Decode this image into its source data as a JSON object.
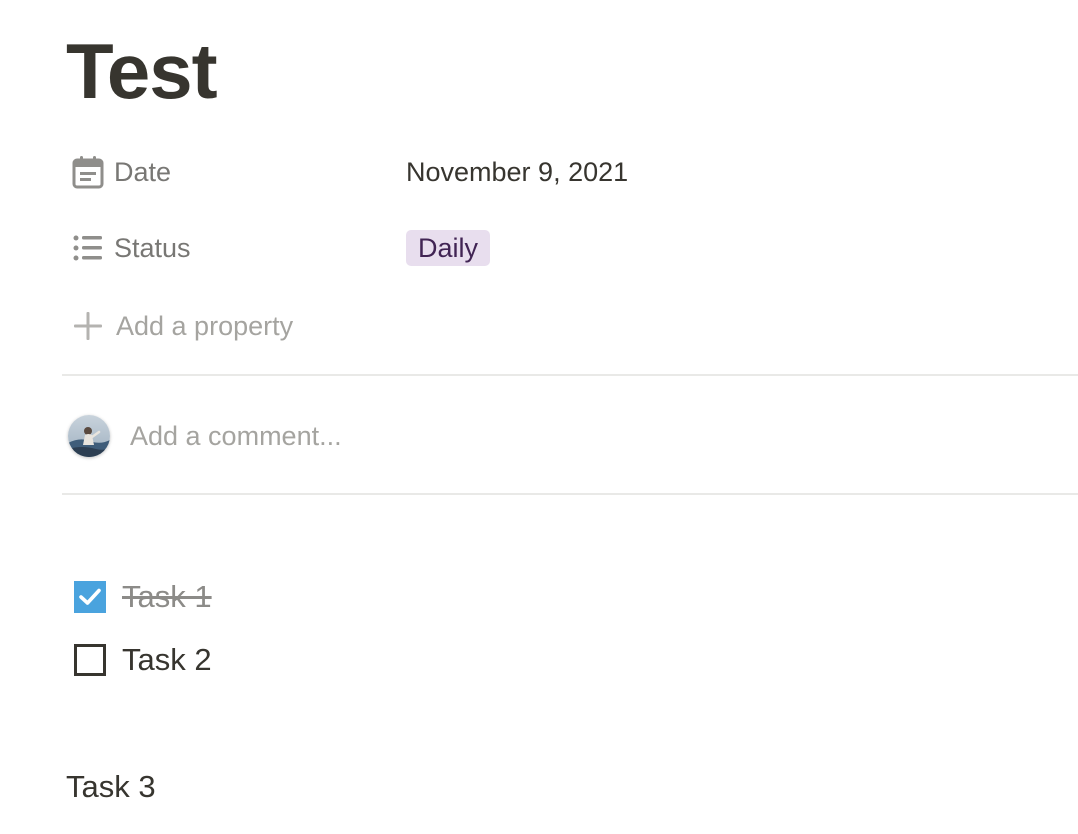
{
  "page": {
    "title": "Test"
  },
  "properties": [
    {
      "icon": "calendar-icon",
      "label": "Date",
      "value": "November 9, 2021"
    },
    {
      "icon": "list-icon",
      "label": "Status",
      "value": "Daily",
      "tag_bg": "#e8deee",
      "tag_color": "#412454"
    }
  ],
  "add_property": {
    "icon": "plus-icon",
    "label": "Add a property"
  },
  "comment": {
    "placeholder": "Add a comment..."
  },
  "todos": [
    {
      "label": "Task 1",
      "checked": true
    },
    {
      "label": "Task 2",
      "checked": false
    }
  ],
  "paragraphs": [
    {
      "text": "Task 3"
    }
  ],
  "colors": {
    "text": "#37352f",
    "muted": "#787774",
    "placeholder": "#a5a4a0",
    "checkbox_checked": "#4aa3de",
    "divider": "#e9e9e7"
  }
}
